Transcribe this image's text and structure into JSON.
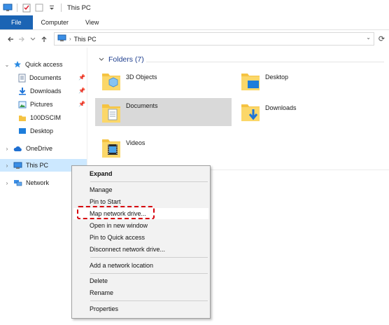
{
  "window": {
    "title": "This PC"
  },
  "ribbon": {
    "tabs": [
      "File",
      "Computer",
      "View"
    ]
  },
  "address": {
    "path": "This PC"
  },
  "sidebar": {
    "quick_access": "Quick access",
    "items": [
      "Documents",
      "Downloads",
      "Pictures",
      "100DSCIM",
      "Desktop"
    ],
    "onedrive": "OneDrive",
    "this_pc": "This PC",
    "network": "Network"
  },
  "folders": {
    "header": "Folders (7)",
    "items": [
      "3D Objects",
      "Desktop",
      "Documents",
      "Downloads",
      "Videos"
    ]
  },
  "context_menu": {
    "items": [
      "Expand",
      "Manage",
      "Pin to Start",
      "Map network drive...",
      "Open in new window",
      "Pin to Quick access",
      "Disconnect network drive...",
      "Add a network location",
      "Delete",
      "Rename",
      "Properties"
    ]
  },
  "colors": {
    "file_tab": "#1b64b4",
    "selection": "#cce8ff",
    "highlight_box": "#d6000d",
    "folder": "#f5c342"
  }
}
